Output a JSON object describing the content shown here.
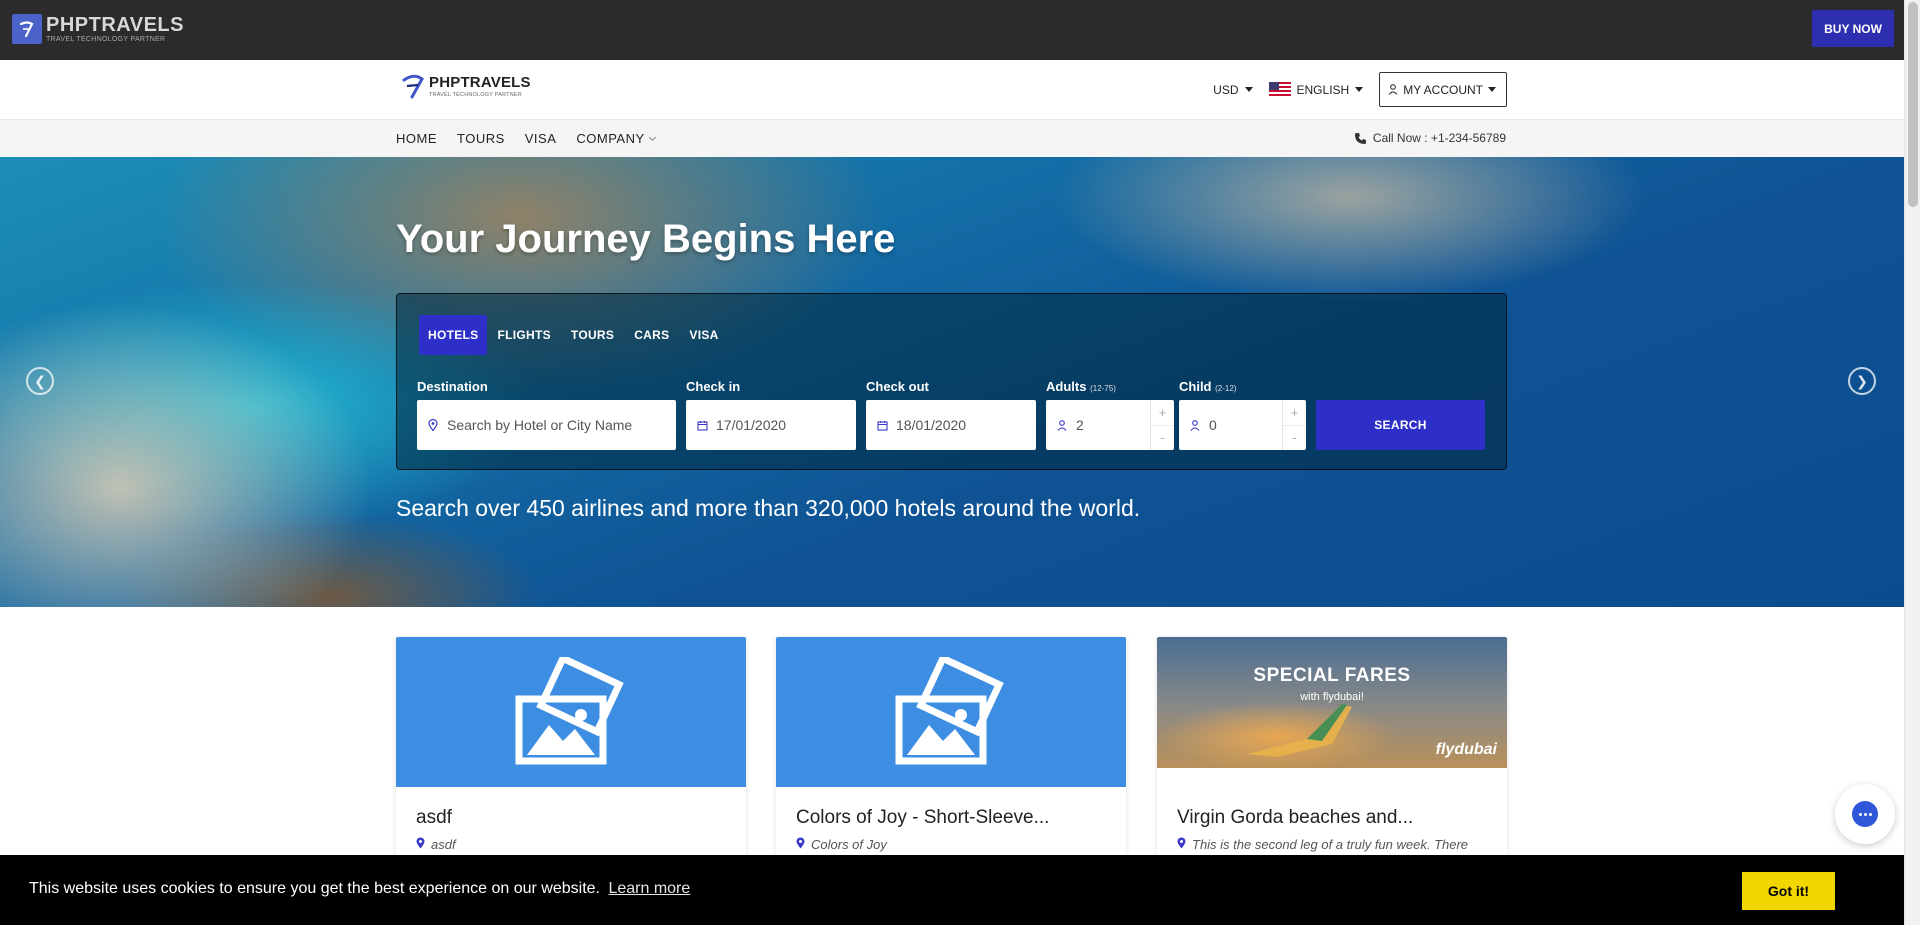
{
  "topbar": {
    "brand_name": "PHPTRAVELS",
    "brand_tagline": "TRAVEL TECHNOLOGY PARTNER",
    "buy_label": "BUY NOW"
  },
  "header": {
    "logo_name": "PHPTRAVELS",
    "logo_tagline": "TRAVEL TECHNOLOGY PARTNER",
    "currency": "USD",
    "language": "ENGLISH",
    "account": "MY ACCOUNT"
  },
  "nav": {
    "items": [
      {
        "label": "HOME"
      },
      {
        "label": "TOURS"
      },
      {
        "label": "VISA"
      },
      {
        "label": "COMPANY"
      }
    ],
    "call": "Call Now : +1-234-56789"
  },
  "hero": {
    "title": "Your Journey Begins Here",
    "tagline": "Search over 450 airlines and more than 320,000 hotels around the world."
  },
  "search": {
    "tabs": [
      "HOTELS",
      "FLIGHTS",
      "TOURS",
      "CARS",
      "VISA"
    ],
    "active_tab": "HOTELS",
    "destination_label": "Destination",
    "destination_placeholder": "Search by Hotel or City Name",
    "checkin_label": "Check in",
    "checkin_value": "17/01/2020",
    "checkout_label": "Check out",
    "checkout_value": "18/01/2020",
    "adults_label": "Adults",
    "adults_range": "(12-75)",
    "adults_value": "2",
    "child_label": "Child",
    "child_range": "(2-12)",
    "child_value": "0",
    "plus": "+",
    "minus": "-",
    "button": "SEARCH"
  },
  "cards": [
    {
      "title": "asdf",
      "location": "asdf"
    },
    {
      "title": "Colors of Joy - Short-Sleeve...",
      "location": "Colors of Joy"
    },
    {
      "title": "Virgin Gorda beaches and...",
      "location": "This is the second leg of a truly fun week. There",
      "promo_title": "SPECIAL FARES",
      "promo_sub": "with flydubai!",
      "promo_brand": "flydubai"
    }
  ],
  "cookie": {
    "message": "This website uses cookies to ensure you get the best experience on our website.",
    "learn_more": "Learn more",
    "accept": "Got it!"
  },
  "colors": {
    "accent": "#2e2fc9",
    "topbar": "#2b2b2b",
    "card_image": "#3d8de3",
    "cookie_button": "#f1d600"
  }
}
